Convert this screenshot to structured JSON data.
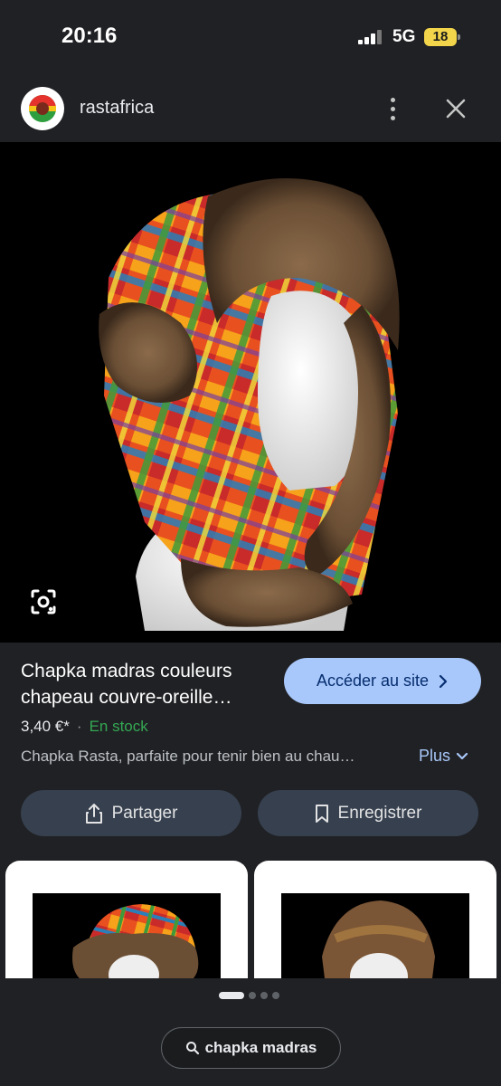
{
  "status_bar": {
    "time": "20:16",
    "network": "5G",
    "battery": "18"
  },
  "header": {
    "site_name": "rastafrica",
    "menu_icon": "more-vert-icon",
    "close_icon": "close-icon"
  },
  "product": {
    "title_line1": "Chapka madras couleurs",
    "title_line2": "chapeau couvre-oreille…",
    "visit_label": "Accéder au site",
    "price": "3,40 €*",
    "separator": "·",
    "stock": "En stock",
    "description": "Chapka Rasta, parfaite pour tenir bien au chau…",
    "more_label": "Plus"
  },
  "actions": {
    "share_label": "Partager",
    "save_label": "Enregistrer"
  },
  "search": {
    "query": "chapka madras"
  },
  "colors": {
    "background": "#202124",
    "accent_button": "#a8c7fa",
    "stock_green": "#34a853",
    "link_blue": "#a8c7fa"
  }
}
